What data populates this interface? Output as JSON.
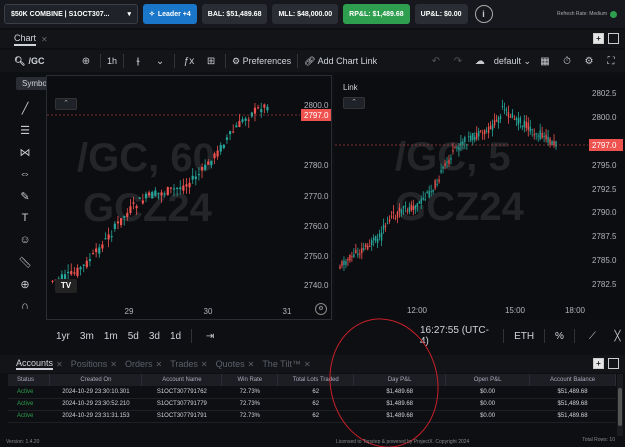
{
  "top_bar": {
    "account_selected": "$50K COMBINE | S1OCT307...",
    "leader_label": "Leader +4",
    "balance": "BAL: $51,489.68",
    "mll": "MLL: $48,000.00",
    "rpl": "RP&L: $1,489.68",
    "upl": "UP&L: $0.00",
    "refresh_rate": "Refresh Rate: Medium",
    "colors": {
      "leader": "#1a76c8",
      "rpl": "#2e9e4f",
      "status_dot": "#2e9e4f"
    }
  },
  "chart_tab": {
    "label": "Chart"
  },
  "chart_toolbar": {
    "symbol": "/GC",
    "interval": "1h",
    "preferences_label": "Preferences",
    "add_chart_link_label": "Add Chart Link",
    "layout": "default"
  },
  "tooltip": "Symbol Search",
  "left_chart": {
    "watermark_line1": "/GC, 60",
    "watermark_line2": "GCZ24",
    "price_ticks": [
      "2800.0",
      "2780.0",
      "2770.0",
      "2760.0",
      "2750.0",
      "2740.0"
    ],
    "current_price": "2797.0",
    "time_ticks": [
      "29",
      "30",
      "31"
    ]
  },
  "right_chart": {
    "link_label": "Link",
    "watermark_line1": "/GC, 5",
    "watermark_line2": "GCZ24",
    "price_ticks": [
      "2802.5",
      "2800.0",
      "2795.0",
      "2792.5",
      "2790.0",
      "2787.5",
      "2785.0",
      "2782.5"
    ],
    "current_price": "2797.0",
    "time_ticks": [
      "12:00",
      "15:00",
      "18:00"
    ]
  },
  "range_bar": {
    "ranges": [
      "1yr",
      "3m",
      "1m",
      "5d",
      "3d",
      "1d"
    ],
    "clock": "16:27:55 (UTC-4)",
    "session": "ETH",
    "percent": "%"
  },
  "bottom_tabs": [
    "Accounts",
    "Positions",
    "Orders",
    "Trades",
    "Quotes",
    "The Tilt™"
  ],
  "accounts_table": {
    "headers": [
      "Status",
      "Created On",
      "Account Name",
      "Win Rate",
      "Total Lots Traded",
      "Day P&L",
      "Open P&L",
      "Account Balance"
    ],
    "rows": [
      [
        "Active",
        "2024-10-29 23:30:10.301",
        "S1OCT307791762",
        "72.73%",
        "62",
        "$1,489.68",
        "$0.00",
        "$51,489.68"
      ],
      [
        "Active",
        "2024-10-29 23:30:52.210",
        "S1OCT307791779",
        "72.73%",
        "62",
        "$1,489.68",
        "$0.00",
        "$51,489.68"
      ],
      [
        "Active",
        "2024-10-29 23:31:31.153",
        "S1OCT307791791",
        "72.73%",
        "62",
        "$1,489.68",
        "$0.00",
        "$51,489.68"
      ]
    ]
  },
  "footer": {
    "version": "Version: 1.4.20",
    "license": "Licensed to Topstep & powered by ProjectX. Copyright 2024",
    "total_rows": "Total Rows: 10"
  }
}
